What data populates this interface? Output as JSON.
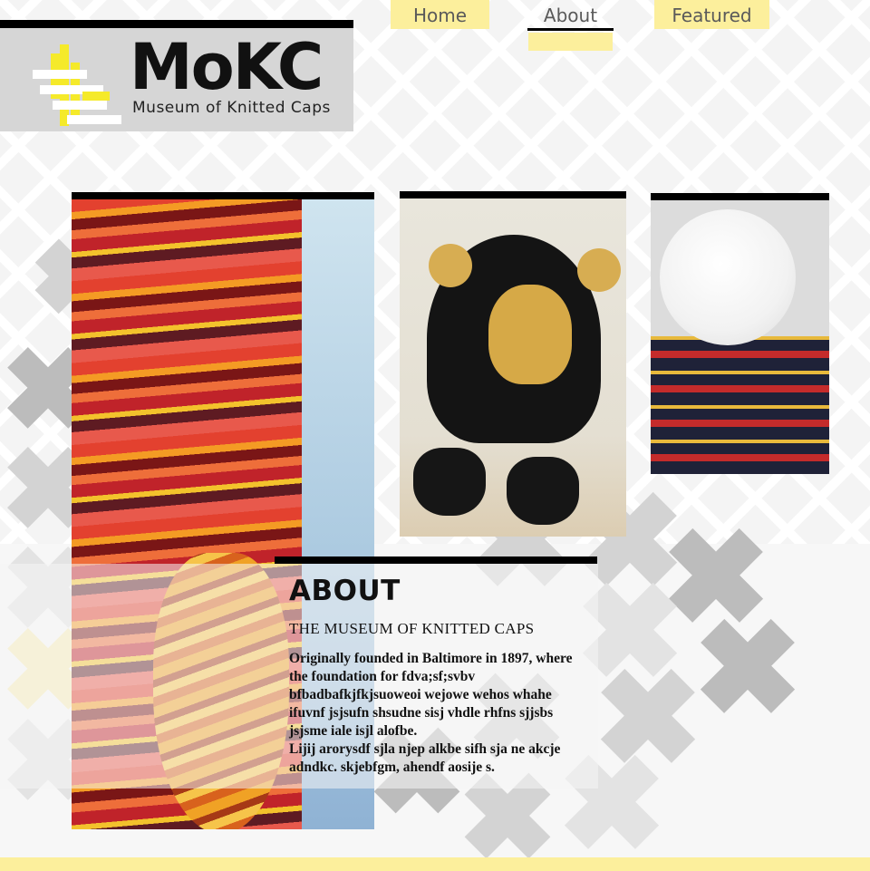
{
  "nav": {
    "home": "Home",
    "about": "About",
    "featured": "Featured",
    "active": "About"
  },
  "logo": {
    "title": "MoKC",
    "subtitle": "Museum of Knitted Caps"
  },
  "about": {
    "heading": "ABOUT",
    "subheading": "THE MUSEUM OF KNITTED CAPS",
    "paragraph_1": "Originally founded in Baltimore in 1897, where the foundation for fdva;sf;svbv bfbadbafkjfkjsuoweoi wejowe wehos whahe ifuvnf jsjsufn shsudne sisj vhdle rhfns sjjsbs jsjsme iale isjl alofbe.",
    "paragraph_2": "Lijij arorysdf sjla njep alkbe sifh sja ne akcje adndkc. skjebfgm, ahendf aosije s."
  },
  "colors": {
    "accent_yellow": "#fcef9c",
    "bar_black": "#000000",
    "logo_gray": "#d6d6d6"
  }
}
